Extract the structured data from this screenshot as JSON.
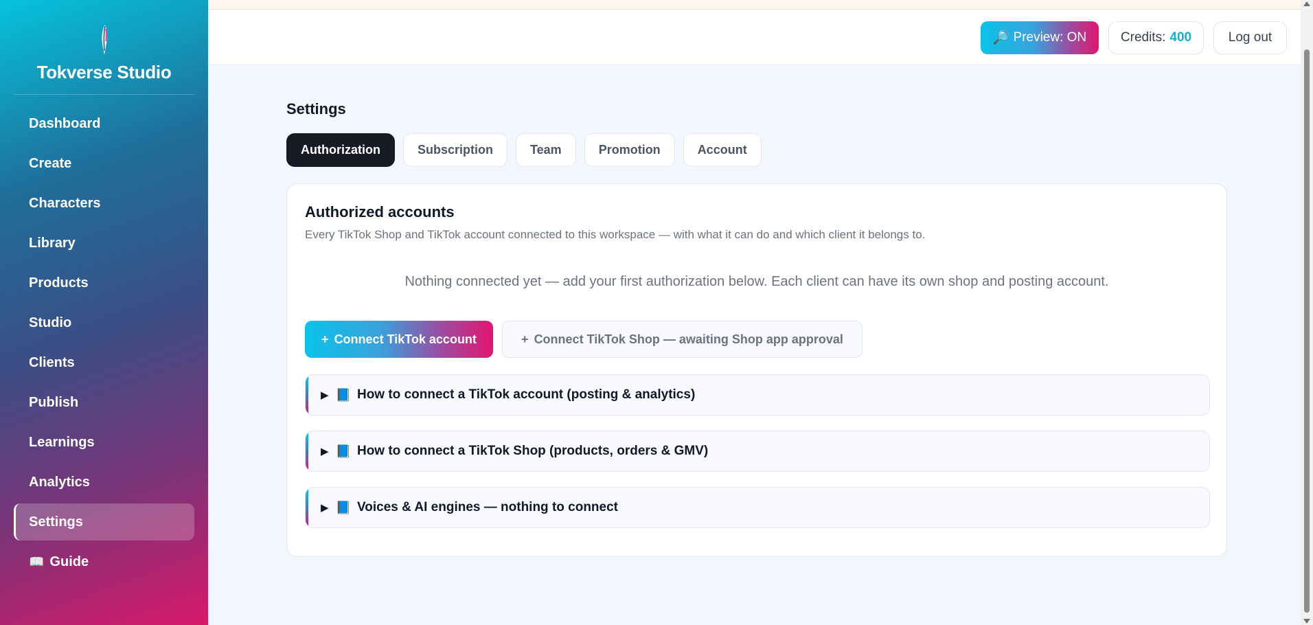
{
  "brand": {
    "name": "Tokverse Studio"
  },
  "sidebar": {
    "items": [
      {
        "label": "Dashboard"
      },
      {
        "label": "Create"
      },
      {
        "label": "Characters"
      },
      {
        "label": "Library"
      },
      {
        "label": "Products"
      },
      {
        "label": "Studio"
      },
      {
        "label": "Clients"
      },
      {
        "label": "Publish"
      },
      {
        "label": "Learnings"
      },
      {
        "label": "Analytics"
      },
      {
        "label": "Settings",
        "active": true
      },
      {
        "label": "Guide",
        "icon": "📖"
      }
    ]
  },
  "topbar": {
    "preview_icon": "🔎",
    "preview_label": "Preview: ON",
    "credits_label": "Credits:",
    "credits_value": "400",
    "logout_label": "Log out"
  },
  "page": {
    "title": "Settings",
    "tabs": [
      {
        "label": "Authorization",
        "active": true
      },
      {
        "label": "Subscription"
      },
      {
        "label": "Team"
      },
      {
        "label": "Promotion"
      },
      {
        "label": "Account"
      }
    ]
  },
  "card": {
    "title": "Authorized accounts",
    "subtitle": "Every TikTok Shop and TikTok account connected to this workspace — with what it can do and which client it belongs to.",
    "empty_message": "Nothing connected yet — add your first authorization below. Each client can have its own shop and posting account.",
    "connect_tiktok_icon": "+",
    "connect_tiktok_label": "Connect TikTok account",
    "connect_shop_icon": "+",
    "connect_shop_label": "Connect TikTok Shop — awaiting Shop app approval",
    "accordions": [
      {
        "arrow": "▶",
        "icon": "📘",
        "label": "How to connect a TikTok account (posting & analytics)"
      },
      {
        "arrow": "▶",
        "icon": "📘",
        "label": "How to connect a TikTok Shop (products, orders & GMV)"
      },
      {
        "arrow": "▶",
        "icon": "📘",
        "label": "Voices & AI engines — nothing to connect"
      }
    ]
  },
  "colors": {
    "accent_cyan": "#0bc3e8",
    "accent_pink": "#e3156f",
    "active_tab": "#161b26",
    "credits_value": "#0bb2d4"
  }
}
